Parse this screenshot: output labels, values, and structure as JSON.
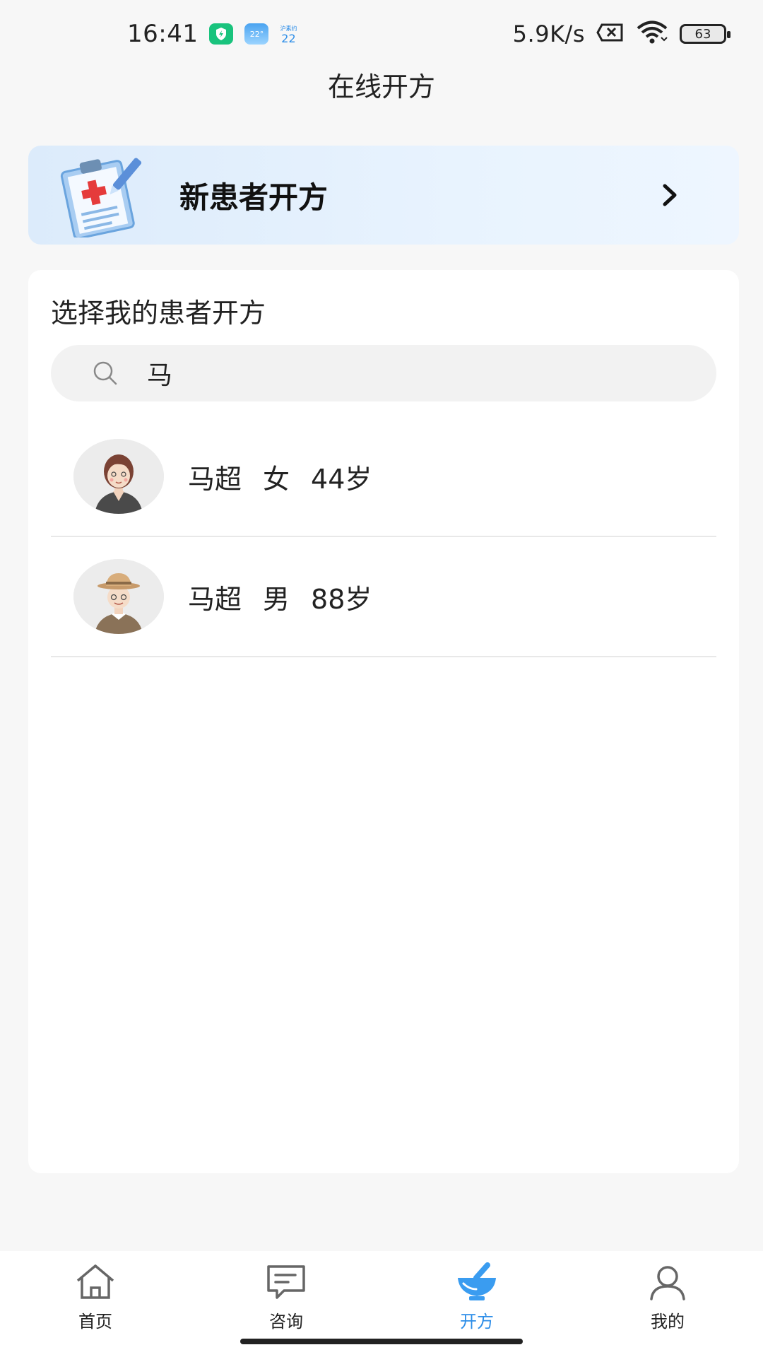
{
  "status_bar": {
    "time": "16:41",
    "weather_badge": "22°",
    "mini_label_top": "沪素约",
    "mini_label_bottom": "22",
    "net_speed": "5.9K/s",
    "battery": "63"
  },
  "header": {
    "title": "在线开方"
  },
  "new_patient": {
    "label": "新患者开方",
    "icon": "clipboard-medical-icon"
  },
  "patients_card": {
    "title": "选择我的患者开方",
    "search": {
      "value": "马",
      "placeholder": ""
    },
    "patients": [
      {
        "name": "马超",
        "gender": "女",
        "age": "44岁",
        "avatar": "female-avatar"
      },
      {
        "name": "马超",
        "gender": "男",
        "age": "88岁",
        "avatar": "elderly-male-avatar"
      }
    ]
  },
  "tabs": [
    {
      "label": "首页",
      "icon": "home-icon",
      "active": false
    },
    {
      "label": "咨询",
      "icon": "chat-icon",
      "active": false
    },
    {
      "label": "开方",
      "icon": "mortar-pestle-icon",
      "active": true
    },
    {
      "label": "我的",
      "icon": "user-icon",
      "active": false
    }
  ],
  "colors": {
    "accent": "#2d8ee8",
    "banner": "#dcebfb",
    "background": "#f7f7f7"
  }
}
